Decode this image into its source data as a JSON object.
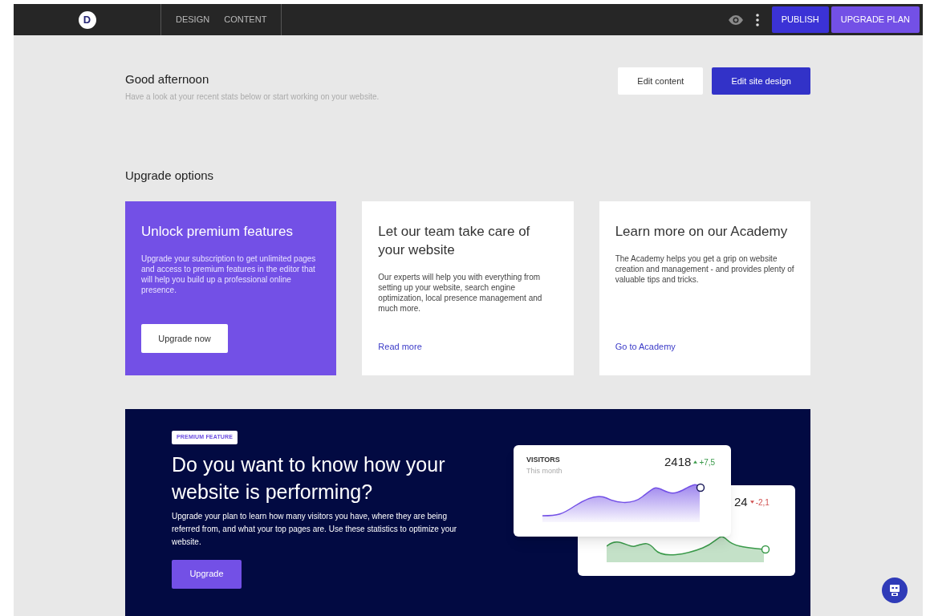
{
  "topbar": {
    "logo": "D",
    "tabs": [
      {
        "label": "DESIGN"
      },
      {
        "label": "CONTENT"
      }
    ],
    "publish": "PUBLISH",
    "upgrade_plan": "UPGRADE PLAN"
  },
  "greeting": {
    "title": "Good afternoon",
    "subtitle": "Have a look at your recent stats below or start working on your website.",
    "buttons": [
      {
        "label": "Edit content",
        "kind": "secondary"
      },
      {
        "label": "Edit site design",
        "kind": "primary"
      }
    ]
  },
  "upgrade_options": {
    "title": "Upgrade options",
    "cards": [
      {
        "kind": "highlight",
        "title": "Unlock premium features",
        "text": "Upgrade your subscription to get unlimited pages and access to premium features in the editor that will help you build up a professional online presence.",
        "action": "Upgrade now"
      },
      {
        "kind": "plain",
        "title": "Let our team take care of your website",
        "text": "Our experts will help you with everything from setting up your website, search engine optimization, local presence management and much more.",
        "action": "Read more"
      },
      {
        "kind": "plain",
        "title": "Learn more on our Academy",
        "text": "The Academy helps you get a grip on website creation and management - and provides plenty of valuable tips and tricks.",
        "action": "Go to Academy"
      }
    ]
  },
  "premium_banner": {
    "badge": "PREMIUM FEATURE",
    "title": "Do you want to know how your website is performing?",
    "text": "Upgrade your plan to learn how many visitors you have, where they are being referred from, and what your top pages are. Use these statistics to optimize your website.",
    "button": "Upgrade",
    "stat_cards": [
      {
        "label": "VISITORS",
        "sublabel": "This month",
        "value": "2418",
        "change": "+7,5",
        "kind": "up"
      },
      {
        "value": "24",
        "change": "-2,1",
        "kind": "down"
      }
    ]
  }
}
